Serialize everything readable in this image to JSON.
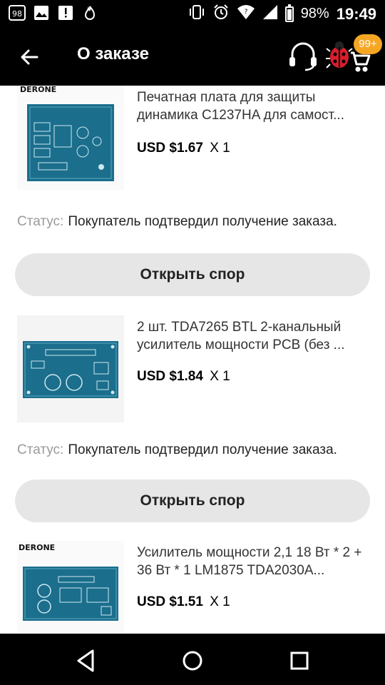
{
  "status_bar": {
    "left_icons": [
      "notification-98-icon",
      "image-icon",
      "alert-icon",
      "flame-icon"
    ],
    "battery": "98%",
    "time": "19:49"
  },
  "appbar": {
    "title": "О заказе",
    "cart_badge": "99+"
  },
  "items": [
    {
      "title": "Печатная плата для защиты динамика C1237HA для самост...",
      "price": "USD $1.67",
      "qty": "X 1",
      "brand": "DERONE",
      "status_label": "Статус:",
      "status_value": "Покупатель подтвердил получение заказа.",
      "button": "Открыть спор"
    },
    {
      "title": "2 шт. TDA7265 BTL 2-канальный усилитель мощности PCB (без ...",
      "price": "USD $1.84",
      "qty": "X 1",
      "brand": "",
      "status_label": "Статус:",
      "status_value": "Покупатель подтвердил получение заказа.",
      "button": "Открыть спор"
    },
    {
      "title": "Усилитель мощности 2,1 18 Вт * 2 + 36 Вт * 1 LM1875 TDA2030A...",
      "price": "USD $1.51",
      "qty": "X 1",
      "brand": "DERONE"
    }
  ],
  "colors": {
    "bar": "#000000",
    "badge": "#f5a623",
    "button_bg": "#e6e6e6",
    "pcb": "#1b6e8c"
  }
}
